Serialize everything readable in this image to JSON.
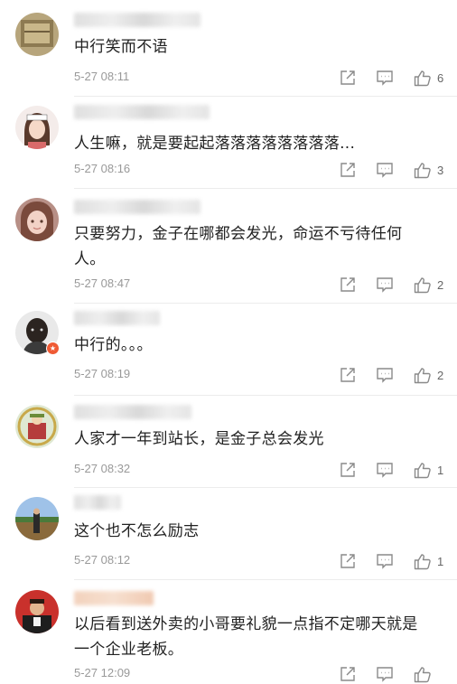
{
  "comments": [
    {
      "content": "中行笑而不语",
      "time": "5-27 08:11",
      "likes": "6"
    },
    {
      "content": "人生嘛，就是要起起落落落落落落落落...",
      "time": "5-27 08:16",
      "likes": "3"
    },
    {
      "content": "只要努力，金子在哪都会发光，命运不亏待任何人。",
      "time": "5-27 08:47",
      "likes": "2"
    },
    {
      "content": "中行的。。。",
      "time": "5-27 08:19",
      "likes": "2"
    },
    {
      "content": "人家才一年到站长，是金子总会发光",
      "time": "5-27 08:32",
      "likes": "1"
    },
    {
      "content": "这个也不怎么励志",
      "time": "5-27 08:12",
      "likes": "1"
    },
    {
      "content": "以后看到送外卖的小哥要礼貌一点指不定哪天就是一个企业老板。",
      "time": "5-27 12:09",
      "likes": ""
    }
  ],
  "icons": {
    "share": "share-icon",
    "reply": "comment-icon",
    "like": "thumbs-up-icon",
    "verified": "verified-badge-icon"
  },
  "colors": {
    "text": "#222222",
    "meta": "#999999",
    "icon": "#8a8a8a",
    "badge": "#ef5a34"
  }
}
